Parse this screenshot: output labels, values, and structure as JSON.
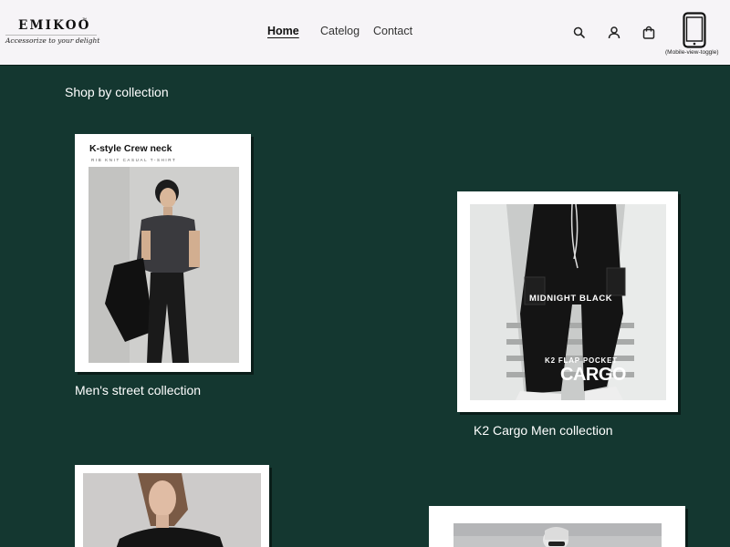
{
  "header": {
    "logo": {
      "name": "EMIKOO",
      "tm": "™",
      "tagline": "Accessorize to your delight"
    },
    "nav": [
      {
        "label": "Home",
        "active": true
      },
      {
        "label": "Catelog",
        "active": false
      },
      {
        "label": "Contact",
        "active": false
      }
    ],
    "icons": [
      "search-icon",
      "user-icon",
      "cart-icon",
      "mobile-phone-icon"
    ],
    "mobile_toggle_label": "(Mobile-view-toggle)"
  },
  "main": {
    "section_title": "Shop by collection",
    "collections": [
      {
        "title": "K-style Crew neck",
        "subtitle": "RIB KNIT CASUAL T-SHIRT",
        "caption": "Men's street collection"
      },
      {
        "tag1": "MIDNIGHT BLACK",
        "tag2": "K2 FLAP POCKET",
        "tag3": "CARGO",
        "caption": "K2 Cargo Men collection"
      },
      {
        "caption": ""
      },
      {
        "caption": ""
      }
    ]
  },
  "colors": {
    "background": "#143730",
    "header_bg": "#f6f4f7",
    "card_bg": "#ffffff",
    "text_light": "#ffffff"
  }
}
